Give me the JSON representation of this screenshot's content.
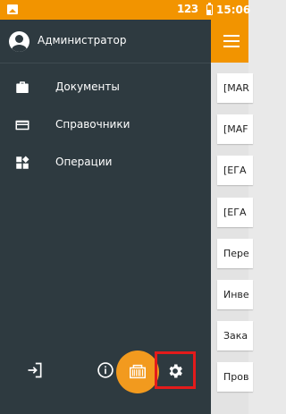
{
  "status_bar": {
    "input_indicator": "123",
    "time": "15:06"
  },
  "drawer": {
    "user_name": "Администратор",
    "items": [
      {
        "label": "Документы",
        "icon": "briefcase-icon"
      },
      {
        "label": "Справочники",
        "icon": "card-icon"
      },
      {
        "label": "Операции",
        "icon": "widgets-icon"
      }
    ],
    "bottom_icons": [
      "logout-icon",
      "info-icon",
      "barcode-scanner-icon",
      "settings-icon"
    ]
  },
  "main_list": {
    "rows": [
      "[MAR",
      "[MAF",
      "[ЕГА",
      "[ЕГА",
      "Пере",
      "Инве",
      "Зака",
      "Пров"
    ]
  },
  "colors": {
    "accent": "#f29400",
    "drawer_bg": "#2e3a40",
    "highlight": "#e41b1b"
  }
}
